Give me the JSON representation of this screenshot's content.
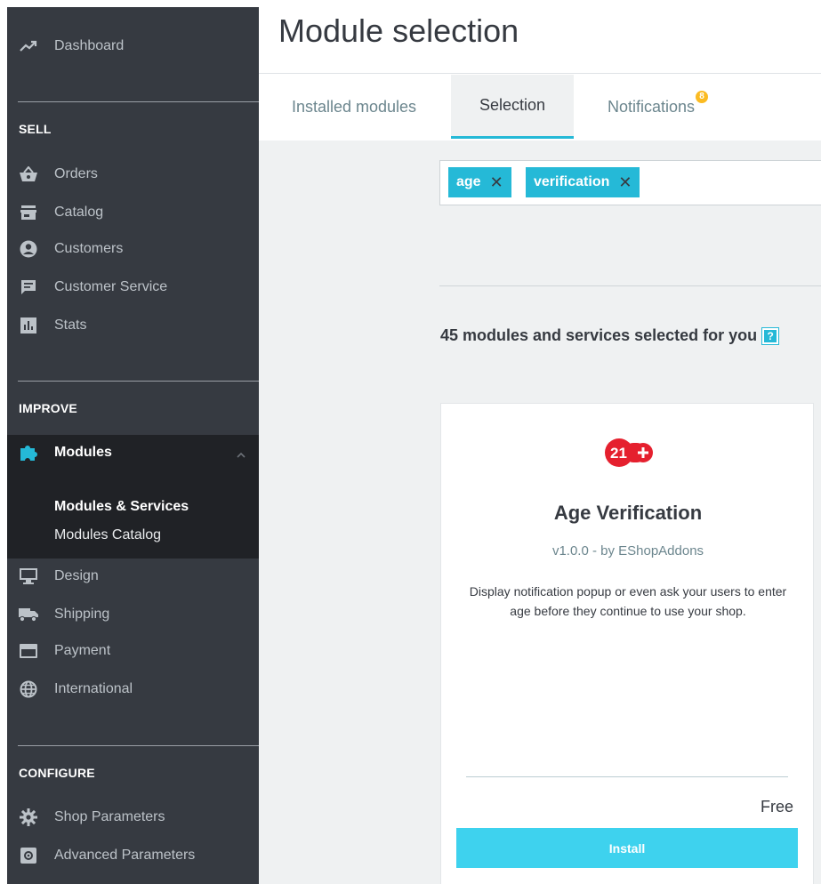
{
  "page": {
    "title": "Module selection"
  },
  "sidebar": {
    "dashboard": "Dashboard",
    "sections": {
      "sell": "SELL",
      "improve": "IMPROVE",
      "configure": "CONFIGURE"
    },
    "sell_items": [
      "Orders",
      "Catalog",
      "Customers",
      "Customer Service",
      "Stats"
    ],
    "modules": {
      "label": "Modules",
      "subitems": [
        "Modules & Services",
        "Modules Catalog"
      ]
    },
    "improve_items": [
      "Design",
      "Shipping",
      "Payment",
      "International"
    ],
    "configure_items": [
      "Shop Parameters",
      "Advanced Parameters"
    ]
  },
  "tabs": [
    {
      "label": "Installed modules",
      "active": false
    },
    {
      "label": "Selection",
      "active": true
    },
    {
      "label": "Notifications",
      "badge": "8",
      "active": false
    }
  ],
  "search": {
    "tags": [
      "age",
      "verification"
    ]
  },
  "summary": {
    "text": "45 modules and services selected for you",
    "help": "?"
  },
  "card": {
    "logo_text": "21+",
    "name": "Age Verification",
    "version": "v1.0.0 - by EShopAddons",
    "description": "Display notification popup or even ask your users to enter age before they continue to use your shop.",
    "price": "Free",
    "install_label": "Install"
  },
  "colors": {
    "sidebar_bg": "#363a41",
    "sidebar_active_bg": "#202226",
    "accent": "#25b9d7",
    "install_button": "#3ed2ee",
    "badge": "#fbbb22",
    "logo_red": "#e5202e"
  },
  "icons": {
    "dashboard": "trending-up-icon",
    "orders": "shopping-basket-icon",
    "catalog": "store-icon",
    "customers": "account-circle-icon",
    "customer_service": "chat-icon",
    "stats": "bar-chart-icon",
    "modules": "puzzle-icon",
    "design": "desktop-icon",
    "shipping": "truck-icon",
    "payment": "credit-card-icon",
    "international": "globe-icon",
    "shop_parameters": "gear-icon",
    "advanced_parameters": "settings-box-icon"
  }
}
